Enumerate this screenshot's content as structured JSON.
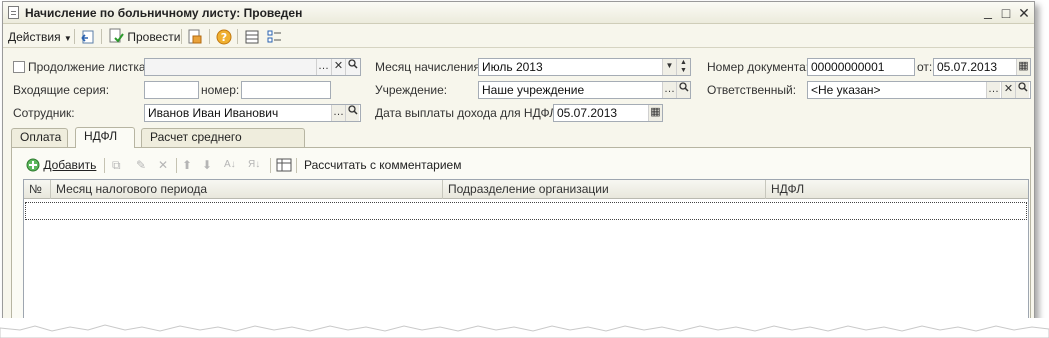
{
  "window": {
    "title": "Начисление по больничному листу: Проведен",
    "buttons": [
      "_",
      "□",
      "✕"
    ]
  },
  "toolbar": {
    "actions_label": "Действия",
    "post_label": "Провести"
  },
  "form": {
    "continuation_label": "Продолжение листка",
    "incoming_series_label": "Входящие серия:",
    "number_label": "номер:",
    "employee_label": "Сотрудник:",
    "employee_value": "Иванов Иван Иванович",
    "month_label": "Месяц начисления:",
    "month_value": "Июль 2013",
    "institution_label": "Учреждение:",
    "institution_value": "Наше учреждение",
    "payout_date_label": "Дата выплаты дохода для НДФЛ:",
    "payout_date_value": "05.07.2013",
    "doc_number_label": "Номер документа:",
    "doc_number_value": "00000000001",
    "doc_date_label": "от:",
    "doc_date_value": "05.07.2013",
    "responsible_label": "Ответственный:",
    "responsible_value": "<Не указан>"
  },
  "tabs": [
    {
      "label": "Оплата"
    },
    {
      "label": "НДФЛ"
    },
    {
      "label": "Расчет среднего заработка"
    }
  ],
  "table_toolbar": {
    "add_label": "Добавить",
    "calc_label": "Рассчитать с комментарием"
  },
  "table": {
    "columns": [
      "№",
      "Месяц налогового периода",
      "Подразделение организации",
      "НДФЛ"
    ]
  },
  "colors": {
    "accent": "#e0a010",
    "window_bg": "#f7f6ec"
  }
}
